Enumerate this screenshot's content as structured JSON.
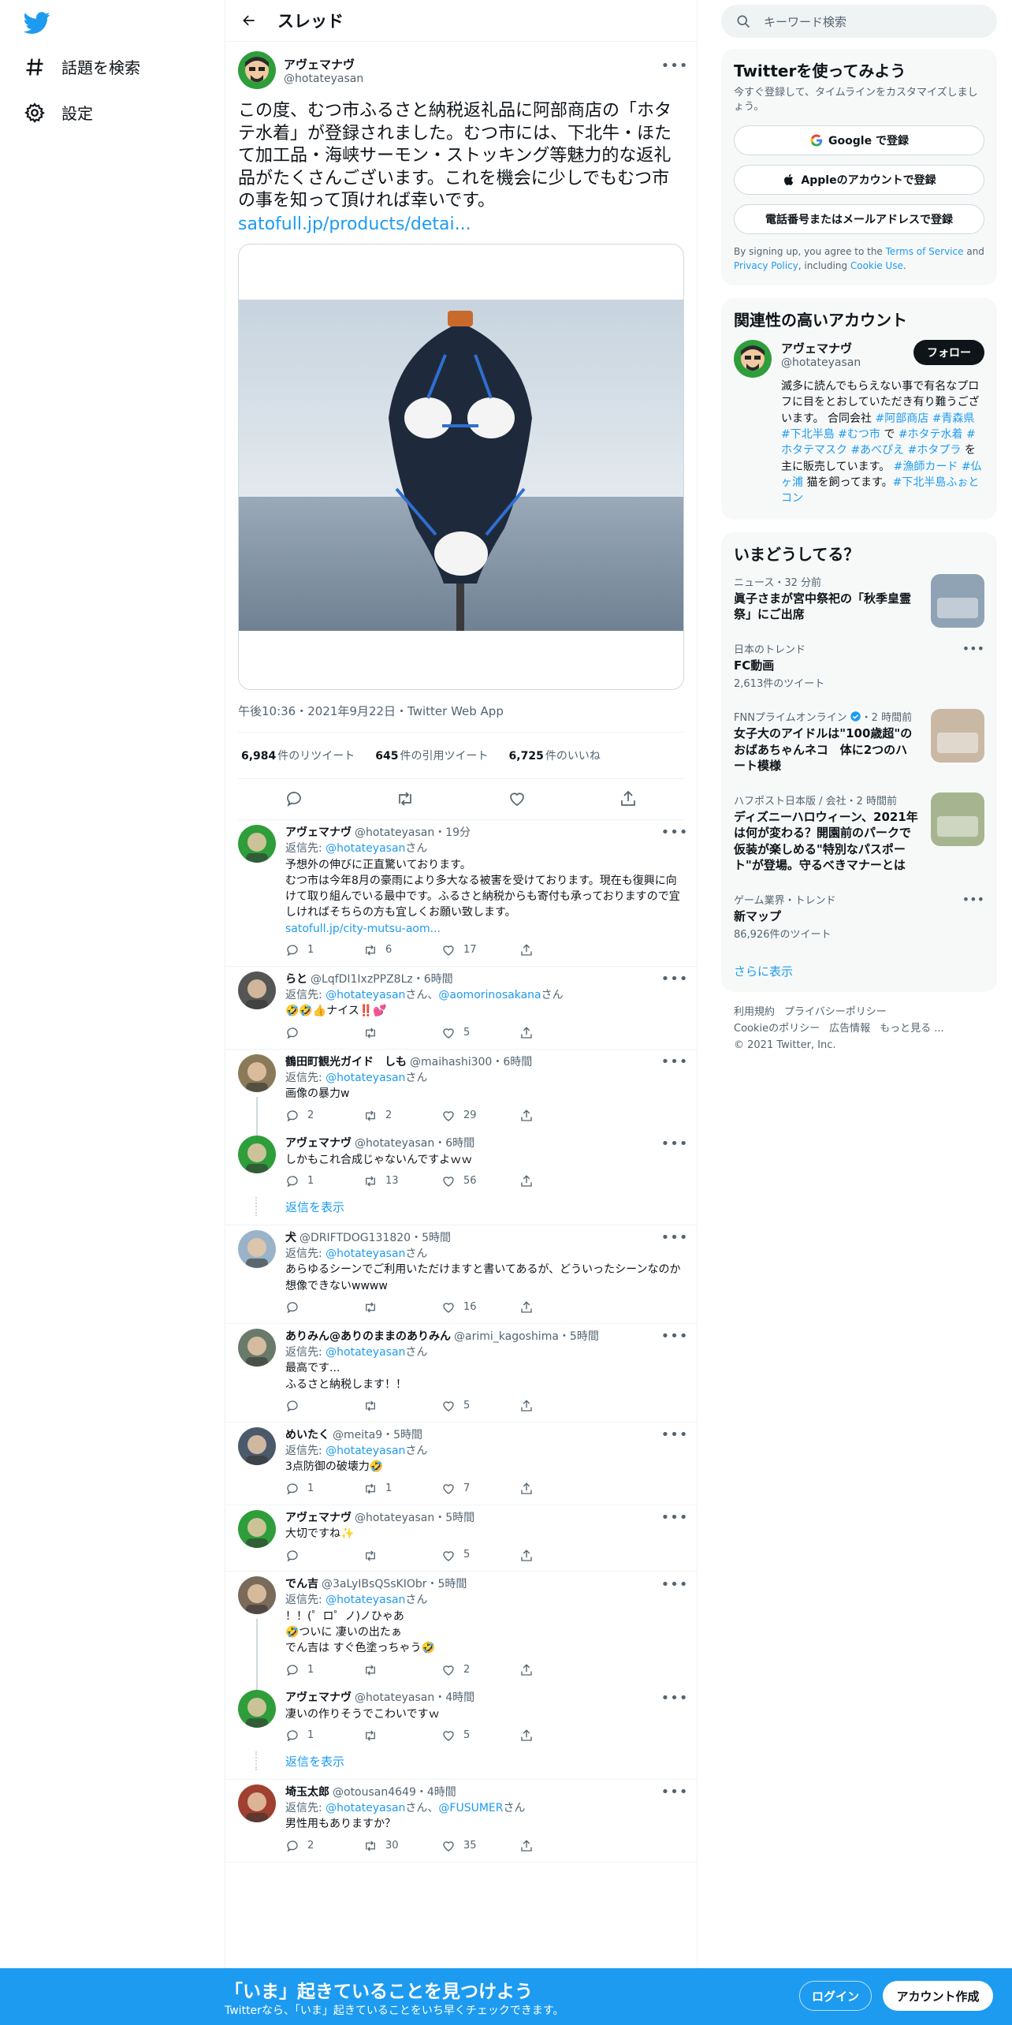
{
  "colors": {
    "accent": "#1d9bf0",
    "text": "#0f1419",
    "muted": "#536471",
    "border": "#eff3f4"
  },
  "nav": {
    "logo_icon": "twitter-bird-icon",
    "items": [
      {
        "label": "話題を検索",
        "icon": "hashtag-icon"
      },
      {
        "label": "設定",
        "icon": "gear-icon"
      }
    ]
  },
  "header": {
    "title": "スレッド"
  },
  "focal": {
    "name": "アヴェマナヴ",
    "handle": "@hotateyasan",
    "text": "この度、むつ市ふるさと納税返礼品に阿部商店の「ホタテ水着」が登録されました。むつ市には、下北牛・ほたて加工品・海峡サーモン・ストッキング等魅力的な返礼品がたくさんございます。これを機会に少しでもむつ市の事を知って頂ければ幸いです。",
    "link": "satofull.jp/products/detai...",
    "meta": "午後10:36・2021年9月22日・Twitter Web App",
    "stats": {
      "retweets": "6,984",
      "retweets_label": "件のリツイート",
      "quotes": "645",
      "quotes_label": "件の引用ツイート",
      "likes": "6,725",
      "likes_label": "件のいいね"
    }
  },
  "replies": [
    {
      "name": "アヴェマナヴ",
      "handle": "@hotateyasan",
      "time": "・19分",
      "reply_prefix": "返信先: ",
      "reply_to": "@hotateyasan",
      "reply_suffix": "さん",
      "text": "予想外の伸びに正直驚いております。\nむつ市は今年8月の豪雨により多大なる被害を受けております。現在も復興に向けて取り組んでいる最中です。ふるさと納税からも寄付も承っておりますので宜しければそちらの方も宜しくお願い致します。",
      "link": "satofull.jp/city-mutsu-aom...",
      "replies": "1",
      "retweets": "6",
      "likes": "17"
    },
    {
      "name": "らと",
      "handle": "@LqfDI1IxzPPZ8Lz",
      "time": "・6時間",
      "reply_prefix": "返信先: ",
      "reply_to": "@hotateyasan",
      "reply_mid": "さん、",
      "reply_to2": "@aomorinosakana",
      "reply_suffix": "さん",
      "text": "🤣🤣👍ナイス‼️💕",
      "replies": "",
      "retweets": "",
      "likes": "5"
    },
    {
      "name": "鶴田町観光ガイド　しも",
      "handle": "@maihashi300",
      "time": "・6時間",
      "reply_prefix": "返信先: ",
      "reply_to": "@hotateyasan",
      "reply_suffix": "さん",
      "text": "画像の暴力w",
      "replies": "2",
      "retweets": "2",
      "likes": "29"
    },
    {
      "name": "アヴェマナヴ",
      "handle": "@hotateyasan",
      "time": "・6時間",
      "text": "しかもこれ合成じゃないんですよｗｗ",
      "replies": "1",
      "retweets": "13",
      "likes": "56"
    },
    {
      "name": "犬",
      "handle": "@DRIFTDOG131820",
      "time": "・5時間",
      "reply_prefix": "返信先: ",
      "reply_to": "@hotateyasan",
      "reply_suffix": "さん",
      "text": "あらゆるシーンでご利用いただけますと書いてあるが、どういったシーンなのか想像できないwwww",
      "replies": "",
      "retweets": "",
      "likes": "16"
    },
    {
      "name": "ありみん@ありのままのありみん",
      "handle": "@arimi_kagoshima",
      "time": "・5時間",
      "reply_prefix": "返信先: ",
      "reply_to": "@hotateyasan",
      "reply_suffix": "さん",
      "text": "最高です...\nふるさと納税します！！",
      "replies": "",
      "retweets": "",
      "likes": "5"
    },
    {
      "name": "めいたく",
      "handle": "@meita9",
      "time": "・5時間",
      "reply_prefix": "返信先: ",
      "reply_to": "@hotateyasan",
      "reply_suffix": "さん",
      "text": "3点防御の破壊力🤣",
      "replies": "1",
      "retweets": "1",
      "likes": "7"
    },
    {
      "name": "アヴェマナヴ",
      "handle": "@hotateyasan",
      "time": "・5時間",
      "text": "大切ですね✨",
      "replies": "",
      "retweets": "",
      "likes": "5"
    },
    {
      "name": "でん吉",
      "handle": "@3aLyIBsQSsKIObr",
      "time": "・5時間",
      "reply_prefix": "返信先: ",
      "reply_to": "@hotateyasan",
      "reply_suffix": "さん",
      "text": "！！(゜ロ゜ノ)ノひゃあ\n🤣ついに 凄いの出たぁ\nでん吉は すぐ色塗っちゃう🤣",
      "replies": "1",
      "retweets": "",
      "likes": "2"
    },
    {
      "name": "アヴェマナヴ",
      "handle": "@hotateyasan",
      "time": "・4時間",
      "text": "凄いの作りそうでこわいですｗ",
      "replies": "1",
      "retweets": "",
      "likes": "5"
    },
    {
      "name": "埼玉太郎",
      "handle": "@otousan4649",
      "time": "・4時間",
      "reply_prefix": "返信先: ",
      "reply_to": "@hotateyasan",
      "reply_mid": "さん、",
      "reply_to2": "@FUSUMER",
      "reply_suffix": "さん",
      "text": "男性用もありますか？",
      "replies": "2",
      "retweets": "30",
      "likes": "35"
    }
  ],
  "show_replies_label": "返信を表示",
  "search": {
    "placeholder": "キーワード検索"
  },
  "signup": {
    "title": "Twitterを使ってみよう",
    "subtitle": "今すぐ登録して、タイムラインをカスタマイズしましょう。",
    "google": "Google で登録",
    "apple": "Appleのアカウントで登録",
    "phone": "電話番号またはメールアドレスで登録",
    "terms_pre": "By signing up, you agree to the ",
    "terms_link": "Terms of Service",
    "terms_and": " and ",
    "privacy_link": "Privacy Policy",
    "terms_incl": ", including ",
    "cookie_link": "Cookie Use",
    "terms_end": "."
  },
  "related": {
    "title": "関連性の高いアカウント",
    "name": "アヴェマナヴ",
    "handle": "@hotateyasan",
    "follow": "フォロー",
    "bio_1": "滅多に読んでもらえない事で有名なプロフに目をとおしていただき有り難うございます。 合同会社 ",
    "tag_1": "#阿部商店",
    "sp_1": " ",
    "tag_2": "#青森県",
    "sp_2": " ",
    "tag_3": "#下北半島",
    "sp_3": " ",
    "tag_4": "#むつ市",
    "bio_2": " で ",
    "tag_5": "#ホタテ水着",
    "sp_4": " ",
    "tag_6": "#ホタテマスク",
    "sp_5": " ",
    "tag_7": "#あべぴえ",
    "sp_6": " ",
    "tag_8": "#ホタプラ",
    "bio_3": " を主に販売しています。 ",
    "tag_9": "#漁師カード",
    "sp_7": " ",
    "tag_10": "#仏ヶ浦",
    "bio_4": " 猫を飼ってます。",
    "tag_11": "#下北半島ふぉとコン"
  },
  "trends": {
    "title": "いまどうしてる？",
    "items": [
      {
        "meta": "ニュース・32 分前",
        "title": "眞子さまが宮中祭祀の「秋季皇霊祭」にご出席",
        "thumb": true
      },
      {
        "meta": "日本のトレンド",
        "title": "FC動画",
        "count": "2,613件のツイート",
        "more": true
      },
      {
        "meta": "FNNプライムオンライン",
        "meta2": "・2 時間前",
        "title": "女子大のアイドルは\"100歳超\"のおばあちゃんネコ　体に2つのハート模様",
        "thumb": true,
        "verified": true
      },
      {
        "meta": "ハフポスト日本版 / 会社",
        "meta2": "・2 時間前",
        "title": "ディズニーハロウィーン、2021年は何が変わる？開園前のパークで仮装が楽しめる\"特別なパスポート\"が登場。守るべきマナーとは",
        "thumb": true
      },
      {
        "meta": "ゲーム業界・トレンド",
        "title": "新マップ",
        "count": "86,926件のツイート",
        "more": true
      }
    ],
    "show_more": "さらに表示"
  },
  "footer": {
    "links": [
      "利用規約",
      "プライバシーポリシー",
      "Cookieのポリシー",
      "広告情報",
      "もっと見る ..."
    ],
    "copyright": "© 2021 Twitter, Inc."
  },
  "bottombar": {
    "title": "「いま」起きていることを見つけよう",
    "subtitle": "Twitterなら、「いま」起きていることをいち早くチェックできます。",
    "login": "ログイン",
    "signup": "アカウント作成"
  }
}
